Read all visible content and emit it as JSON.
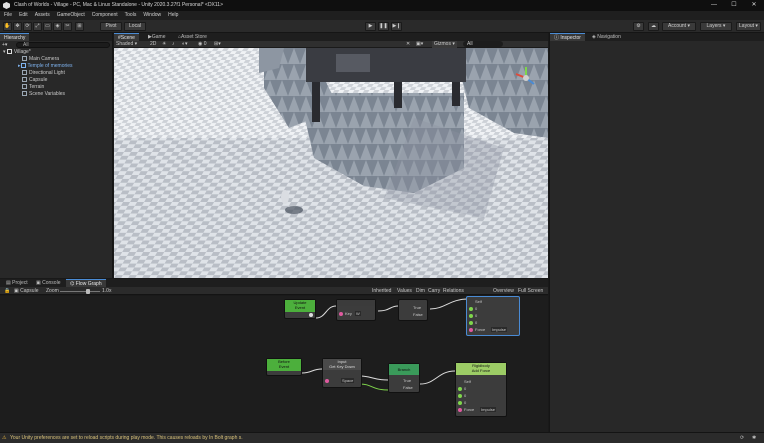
{
  "window": {
    "title": "Clash of Worlds - Village - PC, Mac & Linux Standalone - Unity 2020.3.27f1 Personal* <DX11>",
    "controls": [
      "—",
      "☐",
      "✕"
    ]
  },
  "menu": [
    "File",
    "Edit",
    "Assets",
    "GameObject",
    "Component",
    "Tools",
    "Window",
    "Help"
  ],
  "toolbar": {
    "pivot_label": "Pivot",
    "local_label": "Local",
    "play_icon": "play-icon",
    "pause_icon": "pause-icon",
    "step_icon": "step-icon",
    "account_label": "Account",
    "layers_label": "Layers",
    "layout_label": "Layout"
  },
  "hierarchy": {
    "tab_label": "Hierarchy",
    "search_value": "All",
    "scene_name": "Village*",
    "items": [
      {
        "label": "Main Camera"
      },
      {
        "label": "Temple of memories",
        "highlight": true
      },
      {
        "label": "Directional Light"
      },
      {
        "label": "Capsule"
      },
      {
        "label": "Terrain"
      },
      {
        "label": "Scene Variables"
      }
    ]
  },
  "scene_view": {
    "tabs": [
      "Scene",
      "Game",
      "Asset Store"
    ],
    "shading_mode": "Shaded",
    "mode_2d": "2D",
    "camera_mode": "Gizmos",
    "search_value": "All"
  },
  "inspector": {
    "tabs": [
      "Inspector",
      "Navigation"
    ]
  },
  "bottom": {
    "tabs": [
      "Project",
      "Console",
      "Flow Graph"
    ],
    "zoom_label": "Zoom",
    "zoom_value": "1.0x",
    "graph_label": "Capsule",
    "graph_toolbar": [
      "Inherited",
      "Values",
      "Dim",
      "Carry",
      "Relations",
      "Overview",
      "Full Screen"
    ],
    "nodes": {
      "update": {
        "title": "Update",
        "subtitle": "Event"
      },
      "getkey": {
        "key": "W",
        "label": "Key"
      },
      "branch_top": {
        "true_label": "True",
        "false_label": "False"
      },
      "before": {
        "title": "Before",
        "subtitle": "Event"
      },
      "input": {
        "title": "Input",
        "subtitle": "Get Key Down",
        "key": "Space"
      },
      "branch": {
        "title": "Branch",
        "true_label": "True",
        "false_label": "False"
      },
      "rb_top": {
        "self": "Self",
        "x": "0",
        "y": "0",
        "z": "0",
        "mode": "Force",
        "mode_value": "Impulse"
      },
      "rigidbody": {
        "title": "Rigidbody",
        "subtitle": "Add Force",
        "self": "Self",
        "x": "0",
        "y": "0",
        "z": "0",
        "mode": "Force",
        "mode_value": "Impulse"
      }
    }
  },
  "status": {
    "message": "Your Unity preferences are set to reload scripts during play mode. This causes reloads by In Bolt graph s."
  },
  "colors": {
    "accent": "#4a8bd4",
    "warning": "#d9c27a",
    "event_node": "#4caf3c",
    "branch_node": "#3a9a5a"
  }
}
